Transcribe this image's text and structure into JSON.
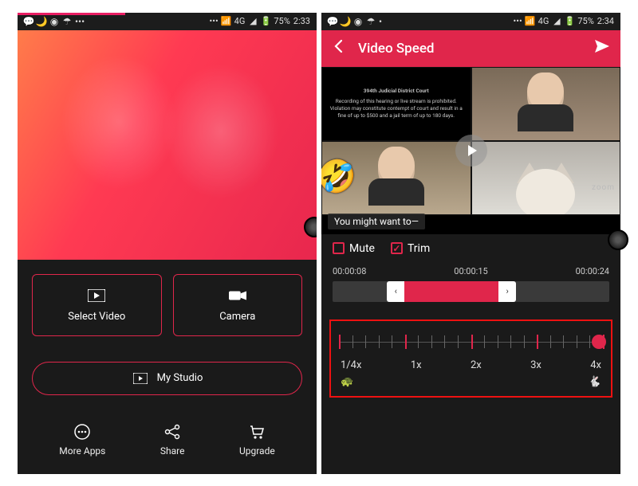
{
  "status": {
    "network": "4G",
    "battery": "75%",
    "time_left": "2:33",
    "time_right": "2:34"
  },
  "left": {
    "select_video": "Select Video",
    "camera": "Camera",
    "my_studio": "My Studio",
    "nav": {
      "more_apps": "More Apps",
      "share": "Share",
      "upgrade": "Upgrade"
    }
  },
  "right": {
    "title": "Video Speed",
    "caption": "You might want to—",
    "court_header": "394th Judicial District Court",
    "court_body": "Recording of this hearing or live stream is prohibited. Violation may constitute contempt of court and result in a fine of up to $500 and a jail term of up to 180 days.",
    "zoom_label": "zoom",
    "mute": "Mute",
    "trim": "Trim",
    "times": {
      "start": "00:00:08",
      "mid": "00:00:15",
      "end": "00:00:24"
    },
    "speeds": [
      "1/4x",
      "1x",
      "2x",
      "3x",
      "4x"
    ],
    "selected_speed": "4x",
    "mute_checked": false,
    "trim_checked": true
  }
}
